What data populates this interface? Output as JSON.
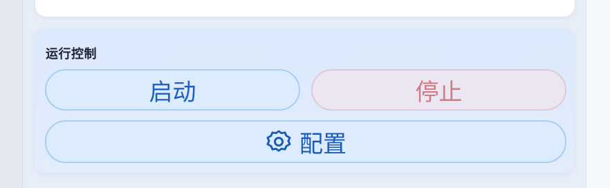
{
  "control": {
    "title": "运行控制",
    "start_label": "启动",
    "stop_label": "停止",
    "config_label": "配置",
    "config_icon": "gear-icon"
  },
  "colors": {
    "start_text": "#1e5fbf",
    "stop_text": "#d07a84",
    "config_text": "#1a5bb8"
  }
}
